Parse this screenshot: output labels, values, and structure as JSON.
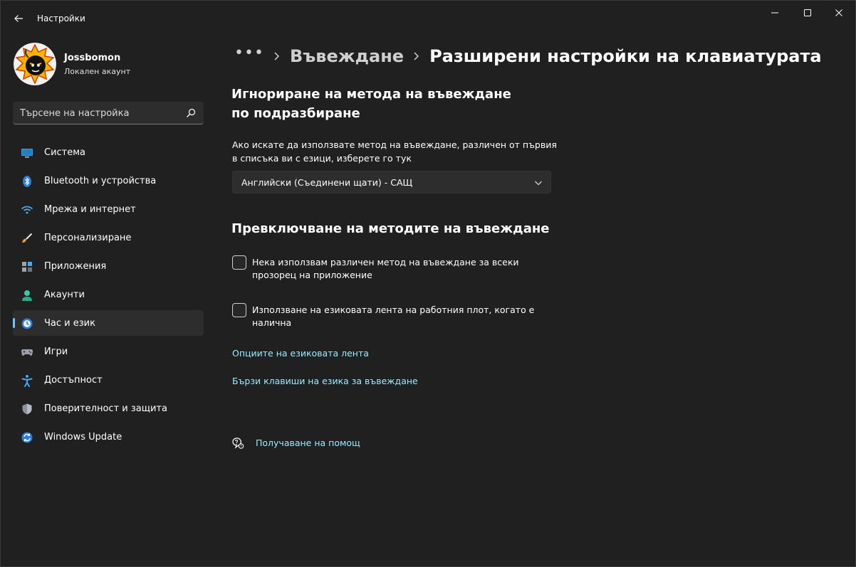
{
  "window": {
    "title": "Настройки"
  },
  "profile": {
    "name": "Jossbomon",
    "account_type": "Локален акаунт"
  },
  "search": {
    "placeholder": "Търсене на настройка"
  },
  "nav": {
    "items": [
      {
        "label": "Система",
        "icon": "system-icon"
      },
      {
        "label": "Bluetooth и устройства",
        "icon": "bluetooth-icon"
      },
      {
        "label": "Мрежа и интернет",
        "icon": "wifi-icon"
      },
      {
        "label": "Персонализиране",
        "icon": "brush-icon"
      },
      {
        "label": "Приложения",
        "icon": "apps-icon"
      },
      {
        "label": "Акаунти",
        "icon": "person-icon"
      },
      {
        "label": "Час и език",
        "icon": "time-language-icon",
        "active": true
      },
      {
        "label": "Игри",
        "icon": "gamepad-icon"
      },
      {
        "label": "Достъпност",
        "icon": "accessibility-icon"
      },
      {
        "label": "Поверителност и защита",
        "icon": "shield-icon"
      },
      {
        "label": "Windows Update",
        "icon": "update-icon"
      }
    ]
  },
  "breadcrumb": {
    "dots": "•••",
    "parent": "Въвеждане",
    "current": "Разширени настройки на клавиатурата"
  },
  "override": {
    "heading": "Игнориране на метода на въвеждане по подразбиране",
    "description": "Ако искате да използвате метод на въвеждане, различен от първия в списъка ви с езици, изберете го тук",
    "dropdown_value": "Английски (Съединени щати) - САЩ"
  },
  "switching": {
    "heading": "Превключване на методите на въвеждане",
    "option1": "Нека използвам различен метод на въвеждане за всеки прозорец на приложение",
    "option1_checked": false,
    "option2": "Използване на езиковата лента на работния плот, когато е налична",
    "option2_checked": false
  },
  "links": {
    "language_bar_options": "Опциите на езиковата лента",
    "hotkeys": "Бързи клавиши на езика за въвеждане"
  },
  "help": {
    "label": "Получаване на помощ"
  },
  "colors": {
    "background": "#202020",
    "accent": "#60cdff",
    "link": "#99ebff"
  }
}
